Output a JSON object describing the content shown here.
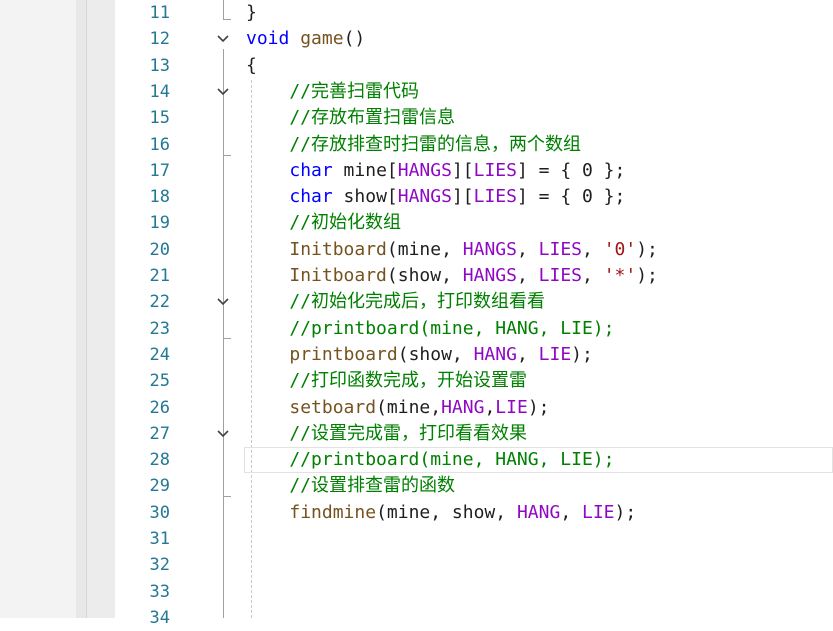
{
  "editor": {
    "lines": [
      {
        "num": "11",
        "fold": false,
        "code": [
          {
            "t": "}",
            "c": "pl"
          }
        ]
      },
      {
        "num": "12",
        "fold": true,
        "code": [
          {
            "t": "void",
            "c": "kw"
          },
          {
            "t": " ",
            "c": "pl"
          },
          {
            "t": "game",
            "c": "fn"
          },
          {
            "t": "()",
            "c": "pl"
          }
        ]
      },
      {
        "num": "13",
        "fold": false,
        "code": [
          {
            "t": "{",
            "c": "pl"
          }
        ]
      },
      {
        "num": "14",
        "fold": true,
        "code": [
          {
            "t": "    //完善扫雷代码",
            "c": "cm"
          }
        ]
      },
      {
        "num": "15",
        "fold": false,
        "code": [
          {
            "t": "    //存放布置扫雷信息",
            "c": "cm"
          }
        ]
      },
      {
        "num": "16",
        "fold": false,
        "code": [
          {
            "t": "    //存放排查时扫雷的信息，两个数组",
            "c": "cm"
          }
        ]
      },
      {
        "num": "17",
        "fold": false,
        "code": [
          {
            "t": "    ",
            "c": "pl"
          },
          {
            "t": "char",
            "c": "kw"
          },
          {
            "t": " mine[",
            "c": "pl"
          },
          {
            "t": "HANGS",
            "c": "mac"
          },
          {
            "t": "][",
            "c": "pl"
          },
          {
            "t": "LIES",
            "c": "mac"
          },
          {
            "t": "] = { 0 };",
            "c": "pl"
          }
        ]
      },
      {
        "num": "18",
        "fold": false,
        "code": [
          {
            "t": "    ",
            "c": "pl"
          },
          {
            "t": "char",
            "c": "kw"
          },
          {
            "t": " show[",
            "c": "pl"
          },
          {
            "t": "HANGS",
            "c": "mac"
          },
          {
            "t": "][",
            "c": "pl"
          },
          {
            "t": "LIES",
            "c": "mac"
          },
          {
            "t": "] = { 0 };",
            "c": "pl"
          }
        ]
      },
      {
        "num": "19",
        "fold": false,
        "code": [
          {
            "t": "    //初始化数组",
            "c": "cm"
          }
        ]
      },
      {
        "num": "20",
        "fold": false,
        "code": [
          {
            "t": "    ",
            "c": "pl"
          },
          {
            "t": "Initboard",
            "c": "fn"
          },
          {
            "t": "(mine, ",
            "c": "pl"
          },
          {
            "t": "HANGS",
            "c": "mac"
          },
          {
            "t": ", ",
            "c": "pl"
          },
          {
            "t": "LIES",
            "c": "mac"
          },
          {
            "t": ", ",
            "c": "pl"
          },
          {
            "t": "'0'",
            "c": "str"
          },
          {
            "t": ");",
            "c": "pl"
          }
        ]
      },
      {
        "num": "21",
        "fold": false,
        "code": [
          {
            "t": "    ",
            "c": "pl"
          },
          {
            "t": "Initboard",
            "c": "fn"
          },
          {
            "t": "(show, ",
            "c": "pl"
          },
          {
            "t": "HANGS",
            "c": "mac"
          },
          {
            "t": ", ",
            "c": "pl"
          },
          {
            "t": "LIES",
            "c": "mac"
          },
          {
            "t": ", ",
            "c": "pl"
          },
          {
            "t": "'*'",
            "c": "str"
          },
          {
            "t": ");",
            "c": "pl"
          }
        ]
      },
      {
        "num": "22",
        "fold": true,
        "code": [
          {
            "t": "    //初始化完成后，打印数组看看",
            "c": "cm"
          }
        ]
      },
      {
        "num": "23",
        "fold": false,
        "code": [
          {
            "t": "    //printboard(mine, HANG, LIE);",
            "c": "cm"
          }
        ]
      },
      {
        "num": "24",
        "fold": false,
        "code": [
          {
            "t": "    ",
            "c": "pl"
          },
          {
            "t": "printboard",
            "c": "fn"
          },
          {
            "t": "(show, ",
            "c": "pl"
          },
          {
            "t": "HANG",
            "c": "mac"
          },
          {
            "t": ", ",
            "c": "pl"
          },
          {
            "t": "LIE",
            "c": "mac"
          },
          {
            "t": ");",
            "c": "pl"
          }
        ]
      },
      {
        "num": "25",
        "fold": false,
        "code": [
          {
            "t": "    //打印函数完成，开始设置雷",
            "c": "cm"
          }
        ]
      },
      {
        "num": "26",
        "fold": false,
        "code": [
          {
            "t": "    ",
            "c": "pl"
          },
          {
            "t": "setboard",
            "c": "fn"
          },
          {
            "t": "(mine,",
            "c": "pl"
          },
          {
            "t": "HANG",
            "c": "mac"
          },
          {
            "t": ",",
            "c": "pl"
          },
          {
            "t": "LIE",
            "c": "mac"
          },
          {
            "t": ");",
            "c": "pl"
          }
        ]
      },
      {
        "num": "27",
        "fold": true,
        "code": [
          {
            "t": "    //设置完成雷，打印看看效果",
            "c": "cm"
          }
        ]
      },
      {
        "num": "28",
        "fold": false,
        "current": true,
        "code": [
          {
            "t": "    //printboard(mine, HANG, LIE);",
            "c": "cm"
          }
        ]
      },
      {
        "num": "29",
        "fold": false,
        "code": [
          {
            "t": "    //设置排查雷的函数",
            "c": "cm"
          }
        ]
      },
      {
        "num": "30",
        "fold": false,
        "code": [
          {
            "t": "    ",
            "c": "pl"
          },
          {
            "t": "findmine",
            "c": "fn"
          },
          {
            "t": "(mine, show, ",
            "c": "pl"
          },
          {
            "t": "HANG",
            "c": "mac"
          },
          {
            "t": ", ",
            "c": "pl"
          },
          {
            "t": "LIE",
            "c": "mac"
          },
          {
            "t": ");",
            "c": "pl"
          }
        ]
      },
      {
        "num": "31",
        "fold": false,
        "code": []
      },
      {
        "num": "32",
        "fold": false,
        "code": []
      },
      {
        "num": "33",
        "fold": false,
        "code": []
      },
      {
        "num": "34",
        "fold": false,
        "code": []
      }
    ]
  },
  "colors": {
    "keyword": "#0000ff",
    "comment": "#008000",
    "macro": "#8f08c4",
    "function": "#74531f",
    "string": "#a31515",
    "line_number": "#237893"
  }
}
